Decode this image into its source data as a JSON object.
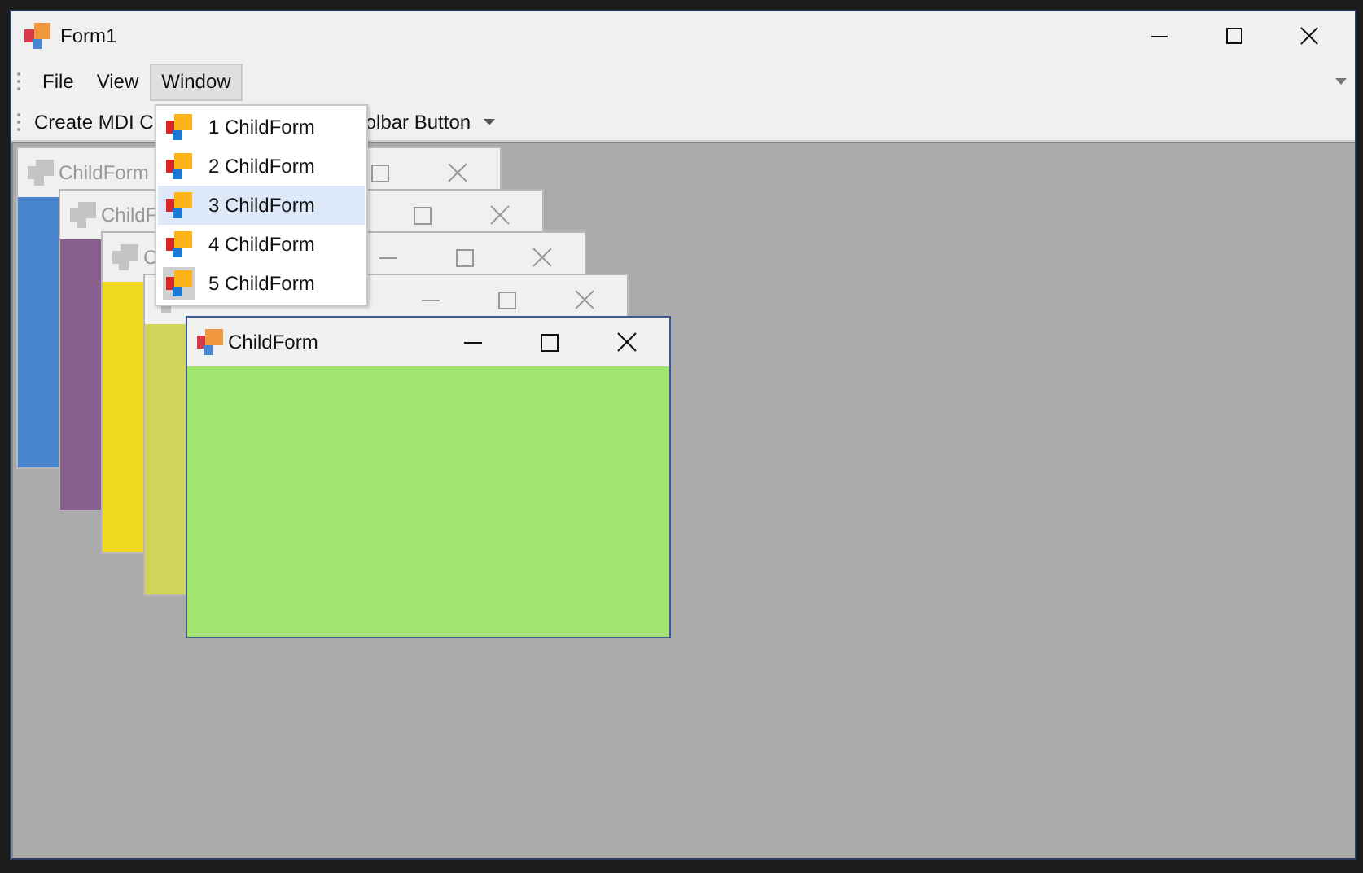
{
  "window": {
    "title": "Form1"
  },
  "menu_bar": {
    "items": [
      {
        "label": "File",
        "selected": false
      },
      {
        "label": "View",
        "selected": false
      },
      {
        "label": "Window",
        "selected": true
      }
    ]
  },
  "toolbar": {
    "items": [
      {
        "label": "Create MDI C",
        "kind": "button"
      },
      {
        "label": "olbar Button",
        "kind": "dropdown"
      }
    ]
  },
  "child_windows": [
    {
      "title": "ChildForm",
      "color": "#4a86cf",
      "active": false
    },
    {
      "title": "ChildF",
      "color": "#87608f",
      "active": false
    },
    {
      "title": "C",
      "color": "#f0d820",
      "active": false
    },
    {
      "color": "#d0d45a",
      "active": false
    },
    {
      "title": "ChildForm",
      "color": "#a2e46e",
      "active": true
    }
  ],
  "window_menu": {
    "items": [
      {
        "label": "1 ChildForm",
        "selected": false,
        "checked": false
      },
      {
        "label": "2 ChildForm",
        "selected": false,
        "checked": false
      },
      {
        "label": "3 ChildForm",
        "selected": true,
        "checked": false
      },
      {
        "label": "4 ChildForm",
        "selected": false,
        "checked": false
      },
      {
        "label": "5 ChildForm",
        "selected": false,
        "checked": true
      }
    ]
  }
}
